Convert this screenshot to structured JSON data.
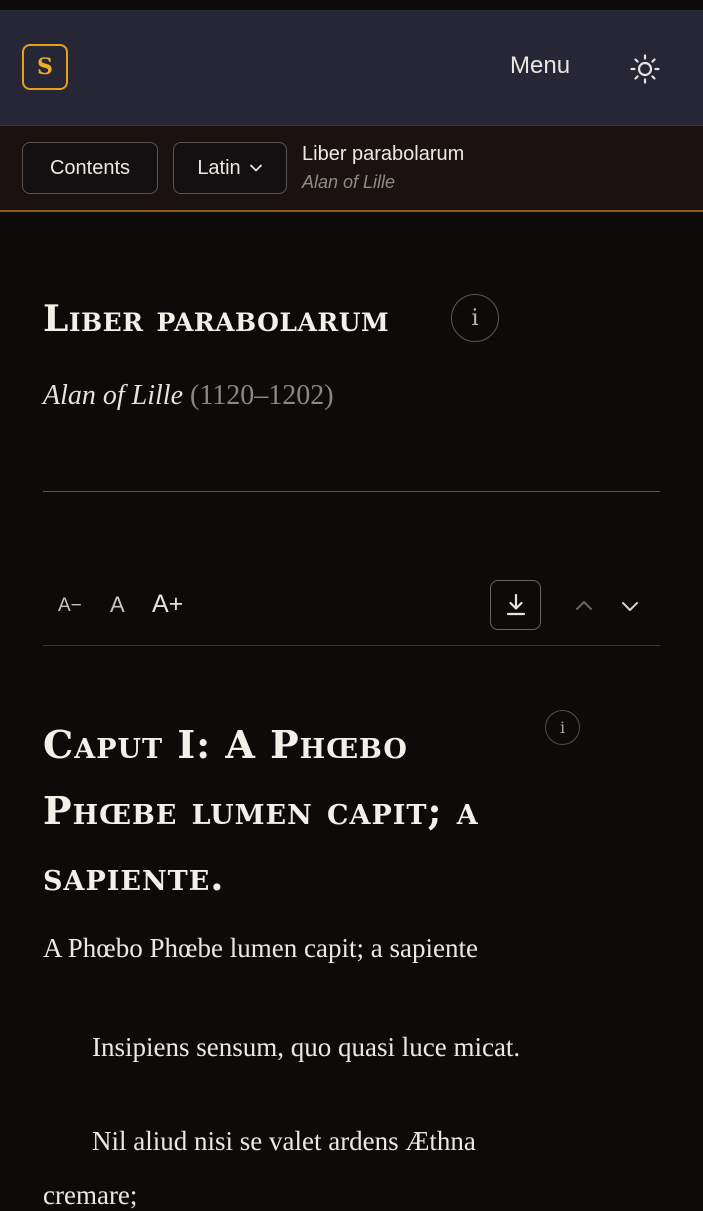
{
  "header": {
    "logo_letter": "S",
    "menu_label": "Menu",
    "theme_icon": "sun-icon"
  },
  "toolbar": {
    "contents_label": "Contents",
    "language_label": "Latin",
    "work_title": "Liber parabolarum",
    "work_author": "Alan of Lille"
  },
  "work": {
    "title": "Liber parabolarum",
    "author": "Alan of Lille",
    "dates": "(1120–1202)"
  },
  "reader_tools": {
    "decrease_font": "A−",
    "reset_font": "A",
    "increase_font": "A+"
  },
  "chapter": {
    "title": "Caput I: A Phœbo Phœbe lumen capit; a sapiente.",
    "lines": [
      "A Phœbo Phœbe lumen capit; a sapiente",
      "Insipiens sensum, quo quasi luce micat.",
      "Nil aliud nisi se valet ardens Æthna",
      "cremare;"
    ]
  },
  "colors": {
    "accent": "#e5a118",
    "header_bg": "#262636",
    "page_bg": "#0c0b0a"
  }
}
